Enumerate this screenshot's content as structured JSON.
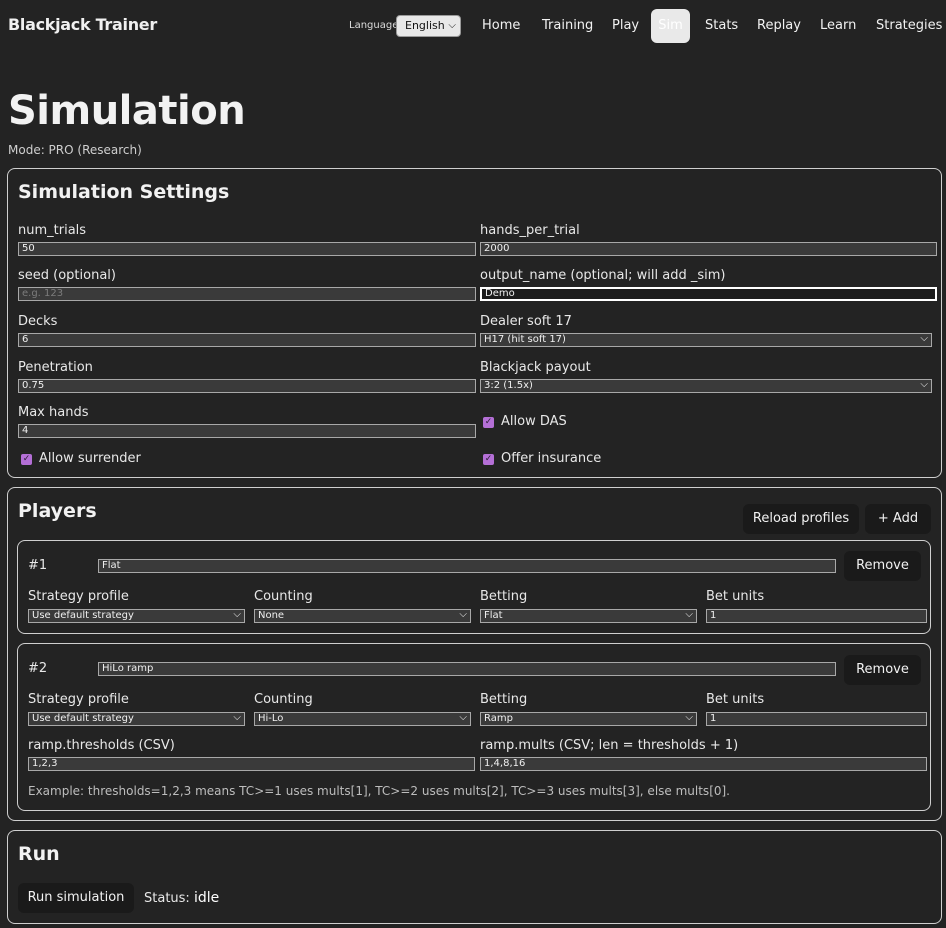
{
  "app": {
    "brand": "Blackjack Trainer",
    "language_label": "Language",
    "language_value": "English",
    "nav": [
      "Home",
      "Training",
      "Play",
      "Sim",
      "Stats",
      "Replay",
      "Learn",
      "Strategies"
    ],
    "active_nav": "Sim"
  },
  "page": {
    "title": "Simulation",
    "mode": "Mode: PRO (Research)"
  },
  "settings": {
    "title": "Simulation Settings",
    "num_trials_label": "num_trials",
    "num_trials": "50",
    "hands_per_trial_label": "hands_per_trial",
    "hands_per_trial": "2000",
    "seed_label": "seed (optional)",
    "seed_placeholder": "e.g. 123",
    "output_name_label": "output_name (optional; will add _sim)",
    "output_name": "Demo",
    "decks_label": "Decks",
    "decks": "6",
    "dealer_label": "Dealer soft 17",
    "dealer_value": "H17 (hit soft 17)",
    "penetration_label": "Penetration",
    "penetration": "0.75",
    "payout_label": "Blackjack payout",
    "payout_value": "3:2 (1.5x)",
    "max_hands_label": "Max hands",
    "max_hands": "4",
    "allow_das_label": "Allow DAS",
    "allow_das": true,
    "allow_surrender_label": "Allow surrender",
    "allow_surrender": true,
    "offer_insurance_label": "Offer insurance",
    "offer_insurance": true
  },
  "players": {
    "title": "Players",
    "reload_label": "Reload profiles",
    "add_label": "+ Add",
    "remove_label": "Remove",
    "strategy_label": "Strategy profile",
    "counting_label": "Counting",
    "betting_label": "Betting",
    "bet_units_label": "Bet units",
    "list": [
      {
        "num": "#1",
        "name": "Flat",
        "strategy": "Use default strategy",
        "counting": "None",
        "betting": "Flat",
        "bet_units": "1"
      },
      {
        "num": "#2",
        "name": "HiLo ramp",
        "strategy": "Use default strategy",
        "counting": "Hi-Lo",
        "betting": "Ramp",
        "bet_units": "1",
        "thresholds_label": "ramp.thresholds (CSV)",
        "thresholds": "1,2,3",
        "mults_label": "ramp.mults (CSV; len = thresholds + 1)",
        "mults": "1,4,8,16",
        "example": "Example: thresholds=1,2,3 means TC>=1 uses mults[1], TC>=2 uses mults[2], TC>=3 uses mults[3], else mults[0]."
      }
    ]
  },
  "run": {
    "title": "Run",
    "button_label": "Run simulation",
    "status_label": "Status:",
    "status_value": "idle"
  },
  "icons": {
    "chevron": "chevron-down-icon",
    "check": "checkmark-icon"
  },
  "colors": {
    "background": "#232323",
    "checkbox_accent": "#b46fd6",
    "active_nav_bg": "#e9e9e9"
  }
}
